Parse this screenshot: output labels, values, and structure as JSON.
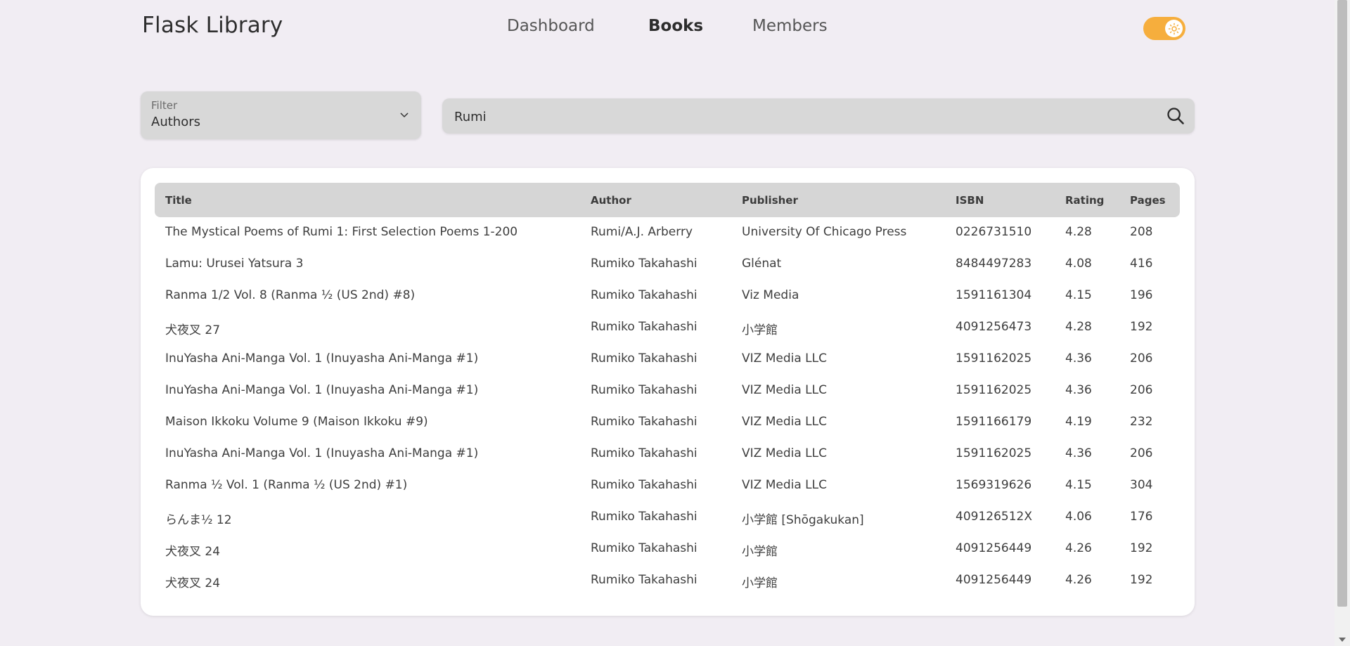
{
  "header": {
    "brand": "Flask Library",
    "nav": {
      "dashboard": "Dashboard",
      "books": "Books",
      "members": "Members"
    },
    "active_nav": "books",
    "theme_toggle": {
      "state": "light",
      "accent": "#f6ae3d"
    }
  },
  "filter": {
    "label": "Filter",
    "value": "Authors"
  },
  "search": {
    "value": "Rumi",
    "icon": "search-icon"
  },
  "table": {
    "columns": {
      "title": "Title",
      "author": "Author",
      "publisher": "Publisher",
      "isbn": "ISBN",
      "rating": "Rating",
      "pages": "Pages"
    },
    "rows": [
      {
        "title": "The Mystical Poems of Rumi 1: First Selection Poems 1-200",
        "author": "Rumi/A.J. Arberry",
        "publisher": "University Of Chicago Press",
        "isbn": "0226731510",
        "rating": "4.28",
        "pages": "208"
      },
      {
        "title": "Lamu: Urusei Yatsura 3",
        "author": "Rumiko Takahashi",
        "publisher": "Glénat",
        "isbn": "8484497283",
        "rating": "4.08",
        "pages": "416"
      },
      {
        "title": "Ranma 1/2 Vol. 8 (Ranma ½ (US 2nd) #8)",
        "author": "Rumiko Takahashi",
        "publisher": "Viz Media",
        "isbn": "1591161304",
        "rating": "4.15",
        "pages": "196"
      },
      {
        "title": "犬夜叉 27",
        "author": "Rumiko Takahashi",
        "publisher": "小学館",
        "isbn": "4091256473",
        "rating": "4.28",
        "pages": "192"
      },
      {
        "title": "InuYasha Ani-Manga Vol. 1 (Inuyasha Ani-Manga #1)",
        "author": "Rumiko Takahashi",
        "publisher": "VIZ Media LLC",
        "isbn": "1591162025",
        "rating": "4.36",
        "pages": "206"
      },
      {
        "title": "InuYasha Ani-Manga Vol. 1 (Inuyasha Ani-Manga #1)",
        "author": "Rumiko Takahashi",
        "publisher": "VIZ Media LLC",
        "isbn": "1591162025",
        "rating": "4.36",
        "pages": "206"
      },
      {
        "title": "Maison Ikkoku Volume 9 (Maison Ikkoku #9)",
        "author": "Rumiko Takahashi",
        "publisher": "VIZ Media LLC",
        "isbn": "1591166179",
        "rating": "4.19",
        "pages": "232"
      },
      {
        "title": "InuYasha Ani-Manga Vol. 1 (Inuyasha Ani-Manga #1)",
        "author": "Rumiko Takahashi",
        "publisher": "VIZ Media LLC",
        "isbn": "1591162025",
        "rating": "4.36",
        "pages": "206"
      },
      {
        "title": "Ranma ½ Vol. 1 (Ranma ½ (US 2nd) #1)",
        "author": "Rumiko Takahashi",
        "publisher": "VIZ Media LLC",
        "isbn": "1569319626",
        "rating": "4.15",
        "pages": "304"
      },
      {
        "title": "らんま½ 12",
        "author": "Rumiko Takahashi",
        "publisher": "小学館 [Shōgakukan]",
        "isbn": "409126512X",
        "rating": "4.06",
        "pages": "176"
      },
      {
        "title": "犬夜叉 24",
        "author": "Rumiko Takahashi",
        "publisher": "小学館",
        "isbn": "4091256449",
        "rating": "4.26",
        "pages": "192"
      },
      {
        "title": "犬夜叉 24",
        "author": "Rumiko Takahashi",
        "publisher": "小学館",
        "isbn": "4091256449",
        "rating": "4.26",
        "pages": "192"
      }
    ]
  },
  "colors": {
    "page_background": "#f1edf3",
    "panel_background": "#ffffff",
    "input_background": "#d8d8d8",
    "table_header_background": "#d6d6d6",
    "toggle_accent": "#f6ae3d"
  }
}
